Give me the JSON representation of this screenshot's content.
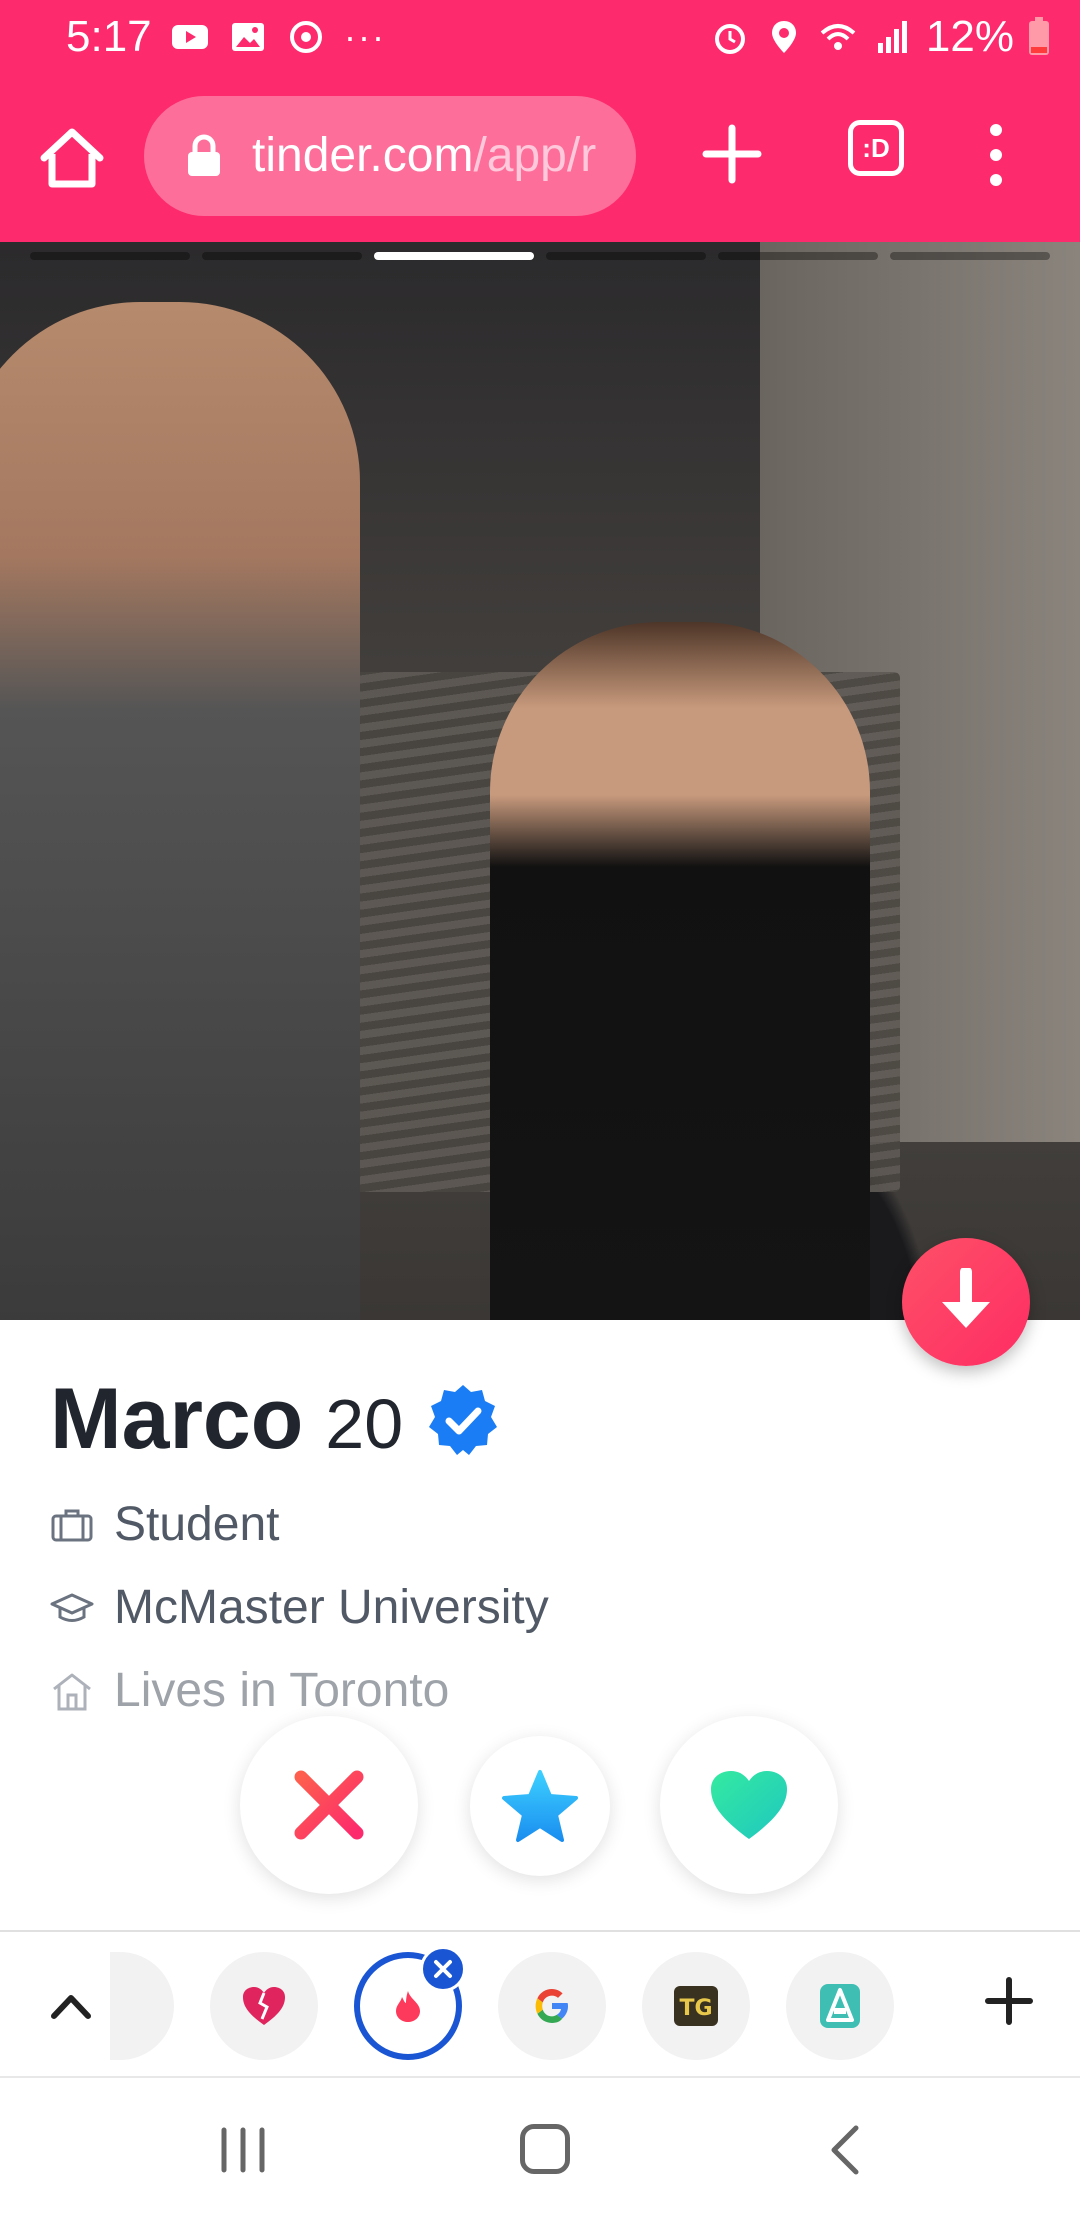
{
  "status_bar": {
    "time": "5:17",
    "more": "···",
    "battery": "12%"
  },
  "browser": {
    "url_main": "tinder.com",
    "url_dim": "/app/r",
    "tabs_label": ":D"
  },
  "photo": {
    "count": 6,
    "active_index": 2
  },
  "profile": {
    "name": "Marco",
    "age": "20",
    "job": "Student",
    "school": "McMaster University",
    "lives": "Lives in Toronto"
  },
  "colors": {
    "brand": "#fd2a6e",
    "nope": "#fd3a5b",
    "superlike": "#2fb6f5",
    "like": "#22e4a8",
    "tab_accent": "#1a55d4"
  },
  "tab_strip": {
    "tabs": [
      "heart-tab",
      "tinder-tab",
      "google-tab",
      "tg-tab",
      "app-tab"
    ]
  }
}
